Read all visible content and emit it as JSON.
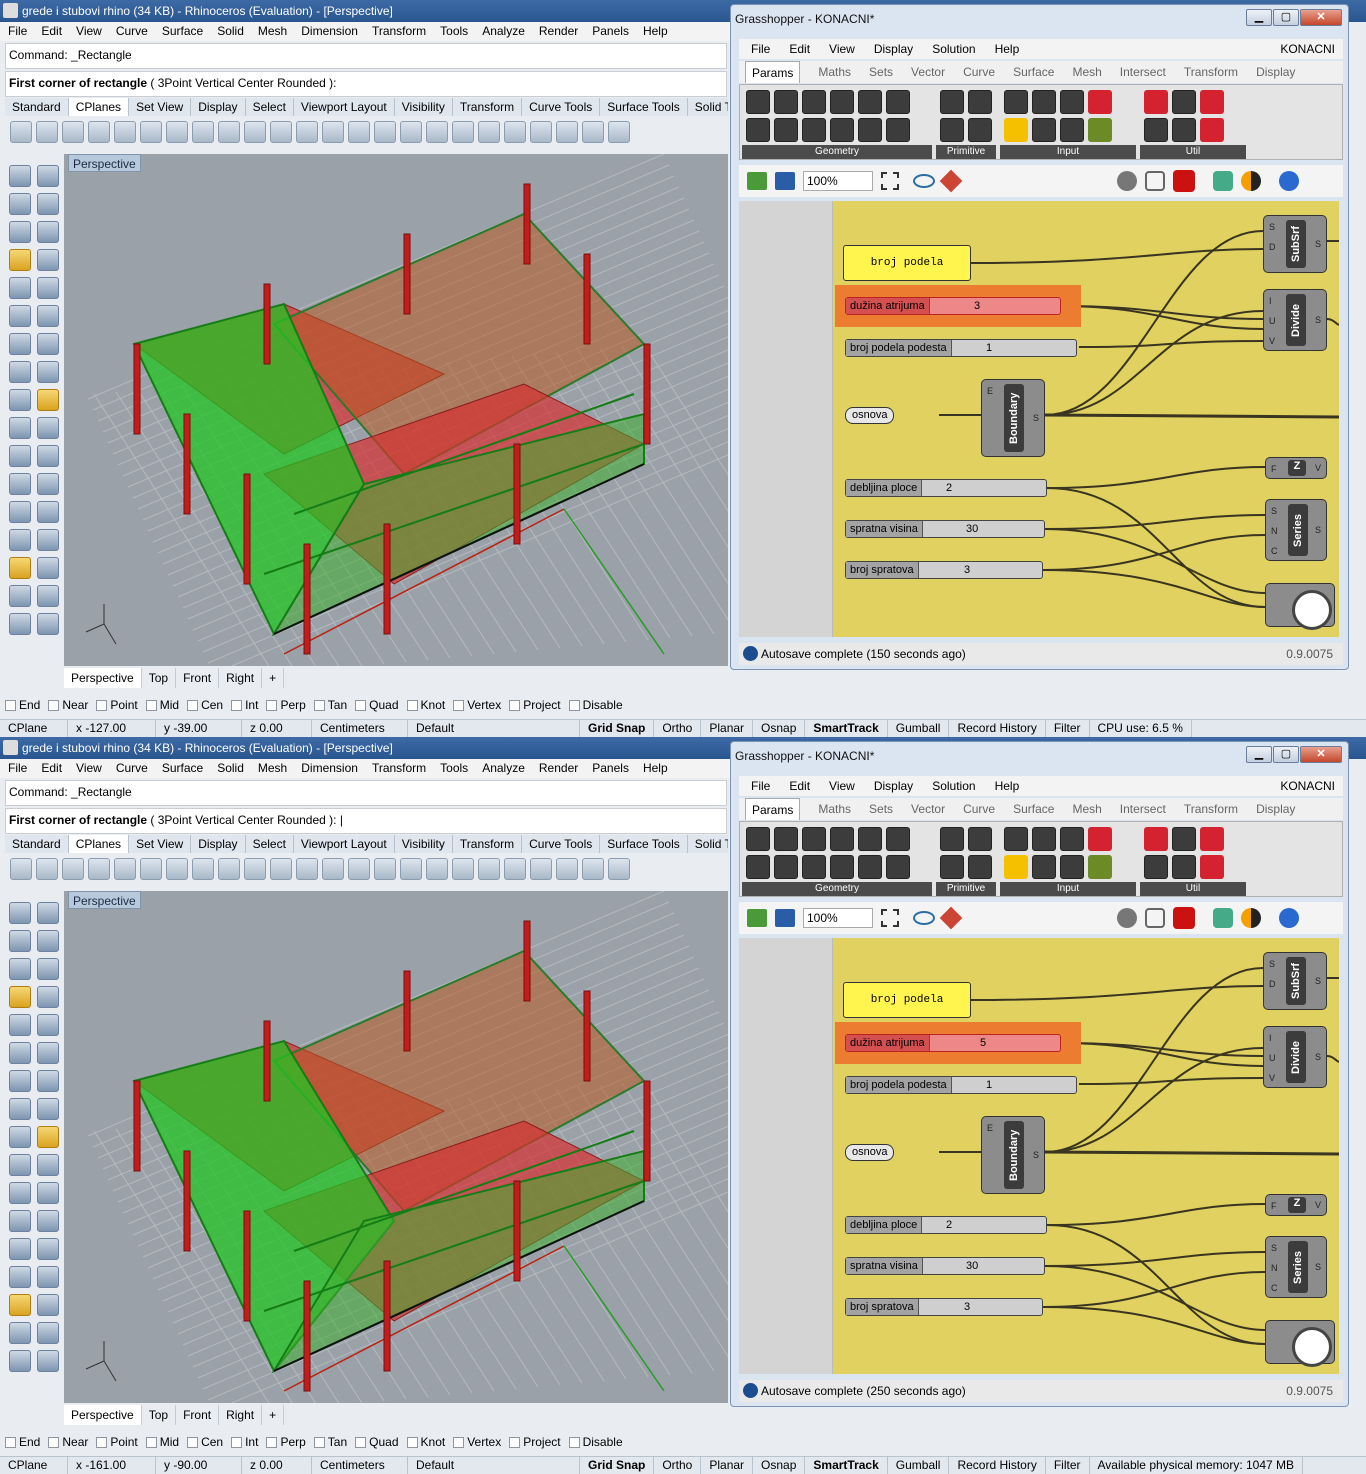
{
  "panels": [
    {
      "rhino": {
        "title": "grede i stubovi rhino (34 KB) - Rhinoceros (Evaluation) - [Perspective]",
        "menu": [
          "File",
          "Edit",
          "View",
          "Curve",
          "Surface",
          "Solid",
          "Mesh",
          "Dimension",
          "Transform",
          "Tools",
          "Analyze",
          "Render",
          "Panels",
          "Help"
        ],
        "command": "Command: _Rectangle",
        "prompt_main": "First corner of rectangle",
        "prompt_opts": " ( 3Point  Vertical  Center  Rounded ):",
        "tabs": [
          "Standard",
          "CPlanes",
          "Set View",
          "Display",
          "Select",
          "Viewport Layout",
          "Visibility",
          "Transform",
          "Curve Tools",
          "Surface Tools",
          "Solid Tools"
        ],
        "active_tab": "CPlanes",
        "viewport_label": "Perspective",
        "viewport_tabs": [
          "Perspective",
          "Top",
          "Front",
          "Right",
          "+"
        ],
        "osnaps": [
          "End",
          "Near",
          "Point",
          "Mid",
          "Cen",
          "Int",
          "Perp",
          "Tan",
          "Quad",
          "Knot",
          "Vertex",
          "Project",
          "Disable"
        ],
        "status": {
          "cplane": "CPlane",
          "x": "x -127.00",
          "y": "y -39.00",
          "z": "z 0.00",
          "units": "Centimeters",
          "layer": "Default",
          "grid_snap": "Grid Snap",
          "ortho": "Ortho",
          "planar": "Planar",
          "osnap": "Osnap",
          "smarttrack": "SmartTrack",
          "gumball": "Gumball",
          "record": "Record History",
          "filter": "Filter",
          "extra": "CPU use: 6.5 %"
        }
      },
      "gh": {
        "title": "Grasshopper - KONACNI*",
        "menu": [
          "File",
          "Edit",
          "View",
          "Display",
          "Solution",
          "Help"
        ],
        "doc": "KONACNI",
        "tabs": [
          "Params",
          "Maths",
          "Sets",
          "Vector",
          "Curve",
          "Surface",
          "Mesh",
          "Intersect",
          "Transform",
          "Display"
        ],
        "groups": [
          "Geometry",
          "Primitive",
          "Input",
          "Util"
        ],
        "zoom": "100%",
        "panel_text": "broj podela",
        "sliders": [
          {
            "label": "dužina atrijuma",
            "value": "3",
            "red": true
          },
          {
            "label": "broj podela podesta",
            "value": "1"
          },
          {
            "label": "debljina ploce",
            "value": "2"
          },
          {
            "label": "spratna visina",
            "value": "30"
          },
          {
            "label": "broj spratova",
            "value": "3"
          }
        ],
        "param": "osnova",
        "components": {
          "subsrf": "SubSrf",
          "divide": "Divide",
          "boundary": "Boundary",
          "z": "Z",
          "series": "Series"
        },
        "status": "Autosave complete (150 seconds ago)",
        "version": "0.9.0075"
      }
    },
    {
      "rhino": {
        "title": "grede i stubovi rhino (34 KB) - Rhinoceros (Evaluation) - [Perspective]",
        "menu": [
          "File",
          "Edit",
          "View",
          "Curve",
          "Surface",
          "Solid",
          "Mesh",
          "Dimension",
          "Transform",
          "Tools",
          "Analyze",
          "Render",
          "Panels",
          "Help"
        ],
        "command": "Command: _Rectangle",
        "prompt_main": "First corner of rectangle",
        "prompt_opts": " ( 3Point  Vertical  Center  Rounded ): |",
        "tabs": [
          "Standard",
          "CPlanes",
          "Set View",
          "Display",
          "Select",
          "Viewport Layout",
          "Visibility",
          "Transform",
          "Curve Tools",
          "Surface Tools",
          "Solid Tools"
        ],
        "active_tab": "CPlanes",
        "viewport_label": "Perspective",
        "viewport_tabs": [
          "Perspective",
          "Top",
          "Front",
          "Right",
          "+"
        ],
        "osnaps": [
          "End",
          "Near",
          "Point",
          "Mid",
          "Cen",
          "Int",
          "Perp",
          "Tan",
          "Quad",
          "Knot",
          "Vertex",
          "Project",
          "Disable"
        ],
        "status": {
          "cplane": "CPlane",
          "x": "x -161.00",
          "y": "y -90.00",
          "z": "z 0.00",
          "units": "Centimeters",
          "layer": "Default",
          "grid_snap": "Grid Snap",
          "ortho": "Ortho",
          "planar": "Planar",
          "osnap": "Osnap",
          "smarttrack": "SmartTrack",
          "gumball": "Gumball",
          "record": "Record History",
          "filter": "Filter",
          "extra": "Available physical memory: 1047 MB"
        }
      },
      "gh": {
        "title": "Grasshopper - KONACNI*",
        "menu": [
          "File",
          "Edit",
          "View",
          "Display",
          "Solution",
          "Help"
        ],
        "doc": "KONACNI",
        "tabs": [
          "Params",
          "Maths",
          "Sets",
          "Vector",
          "Curve",
          "Surface",
          "Mesh",
          "Intersect",
          "Transform",
          "Display"
        ],
        "groups": [
          "Geometry",
          "Primitive",
          "Input",
          "Util"
        ],
        "zoom": "100%",
        "panel_text": "broj podela",
        "sliders": [
          {
            "label": "dužina atrijuma",
            "value": "5",
            "red": true
          },
          {
            "label": "broj podela podesta",
            "value": "1"
          },
          {
            "label": "debljina ploce",
            "value": "2"
          },
          {
            "label": "spratna visina",
            "value": "30"
          },
          {
            "label": "broj spratova",
            "value": "3"
          }
        ],
        "param": "osnova",
        "components": {
          "subsrf": "SubSrf",
          "divide": "Divide",
          "boundary": "Boundary",
          "z": "Z",
          "series": "Series"
        },
        "status": "Autosave complete (250 seconds ago)",
        "version": "0.9.0075"
      }
    }
  ],
  "colors": {
    "accent": "#2a5690",
    "gh_canvas": "#e0d161",
    "green_geometry": "#2fc52f",
    "red_geometry": "#d62f2f"
  }
}
